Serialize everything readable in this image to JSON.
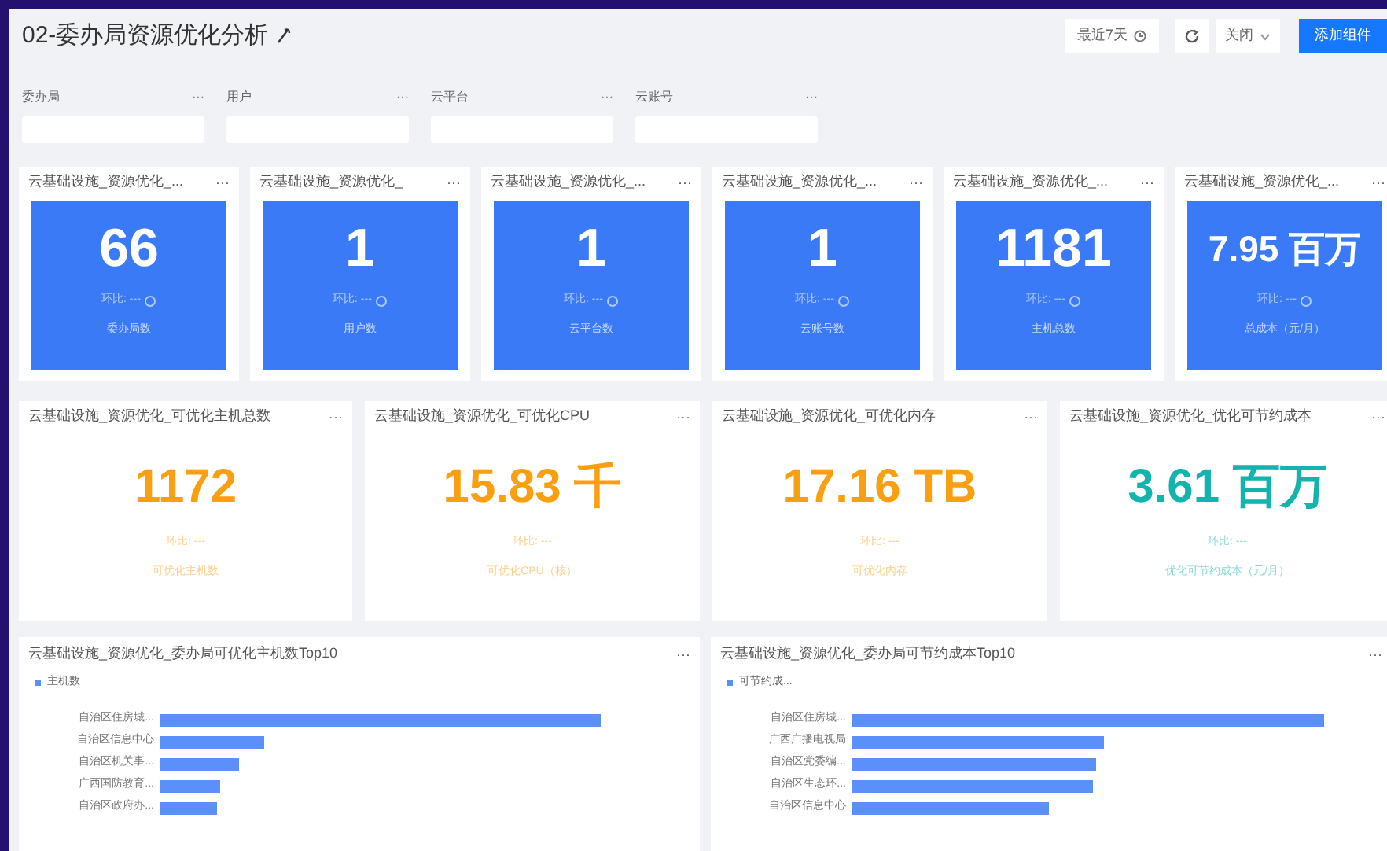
{
  "header": {
    "title": "02-委办局资源优化分析",
    "time_range": "最近7天",
    "close_label": "关闭",
    "add_button": "添加组件"
  },
  "filters": [
    {
      "label": "委办局",
      "more": "···"
    },
    {
      "label": "用户",
      "more": "···"
    },
    {
      "label": "云平台",
      "more": "···"
    },
    {
      "label": "云账号",
      "more": "···"
    }
  ],
  "kpi_row_1": [
    {
      "title": "云基础设施_资源优化_...",
      "more": "···",
      "value": "66",
      "compare": "环比: ---",
      "label": "委办局数",
      "kind": "filled",
      "color": "#3b7af7"
    },
    {
      "title": "云基础设施_资源优化_",
      "more": "···",
      "value": "1",
      "compare": "环比: ---",
      "label": "用户数",
      "kind": "filled",
      "color": "#3b7af7"
    },
    {
      "title": "云基础设施_资源优化_...",
      "more": "···",
      "value": "1",
      "compare": "环比: ---",
      "label": "云平台数",
      "kind": "filled",
      "color": "#3b7af7"
    },
    {
      "title": "云基础设施_资源优化_...",
      "more": "···",
      "value": "1",
      "compare": "环比: ---",
      "label": "云账号数",
      "kind": "filled",
      "color": "#3b7af7"
    },
    {
      "title": "云基础设施_资源优化_...",
      "more": "···",
      "value": "1181",
      "compare": "环比: ---",
      "label": "主机总数",
      "kind": "filled",
      "color": "#3b7af7"
    },
    {
      "title": "云基础设施_资源优化_...",
      "more": "···",
      "value": "7.95 百万",
      "compare": "环比: ---",
      "label": "总成本（元/月）",
      "kind": "filled",
      "color": "#3b7af7"
    }
  ],
  "kpi_row_2": [
    {
      "title": "云基础设施_资源优化_可优化主机总数",
      "more": "···",
      "value": "1172",
      "compare": "环比: ---",
      "label": "可优化主机数",
      "kind": "plain",
      "color": "#fa9f0f"
    },
    {
      "title": "云基础设施_资源优化_可优化CPU",
      "more": "···",
      "value": "15.83 千",
      "compare": "环比: ---",
      "label": "可优化CPU（核）",
      "kind": "plain",
      "color": "#fa9f0f"
    },
    {
      "title": "云基础设施_资源优化_可优化内存",
      "more": "···",
      "value": "17.16 TB",
      "compare": "环比: ---",
      "label": "可优化内存",
      "kind": "plain",
      "color": "#fa9f0f"
    },
    {
      "title": "云基础设施_资源优化_优化可节约成本",
      "more": "···",
      "value": "3.61 百万",
      "compare": "环比: ---",
      "label": "优化可节约成本（元/月）",
      "kind": "plain",
      "color": "#13b4ae"
    }
  ],
  "charts": [
    {
      "title": "云基础设施_资源优化_委办局可优化主机数Top10",
      "more": "···",
      "legend": "主机数",
      "categories": [
        "自治区住房城...",
        "自治区信息中心",
        "自治区机关事...",
        "广西国防教育...",
        "自治区政府办..."
      ]
    },
    {
      "title": "云基础设施_资源优化_委办局可节约成本Top10",
      "more": "···",
      "legend": "可节约成...",
      "categories": [
        "自治区住房城...",
        "广西广播电视局",
        "自治区党委编...",
        "自治区生态环...",
        "自治区信息中心"
      ]
    }
  ]
}
